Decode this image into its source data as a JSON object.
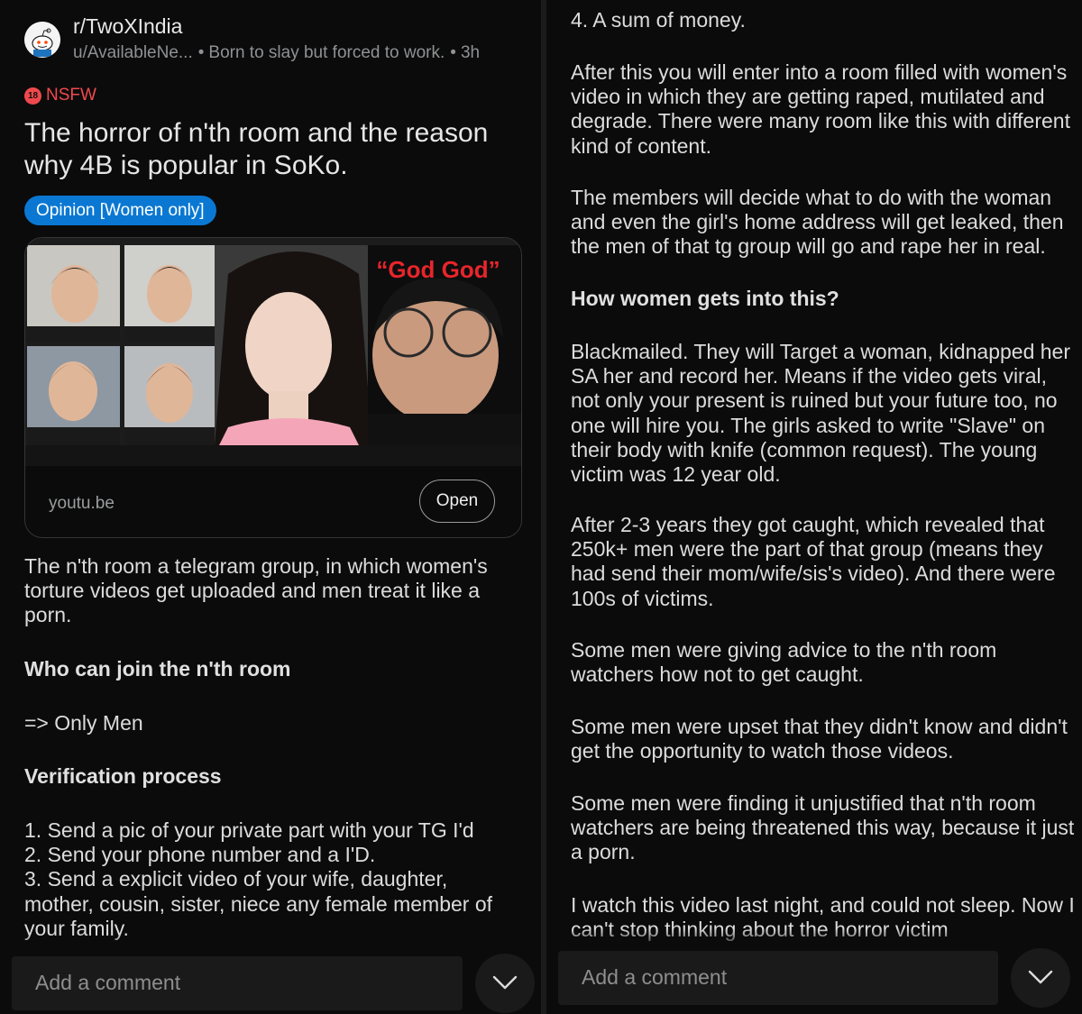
{
  "left": {
    "subreddit": "r/TwoXIndia",
    "username": "u/AvailableNe...",
    "tagline": "Born to slay but forced to work.",
    "time": "3h",
    "nsfw_badge": "18",
    "nsfw_label": "NSFW",
    "title": "The horror of n'th room and the reason why 4B is popular in SoKo.",
    "flair": "Opinion [Women only]",
    "preview": {
      "thumb_caption": "“God God”",
      "domain": "youtu.be",
      "open_label": "Open"
    },
    "paragraphs": [
      "The n'th room a telegram group, in which women's torture videos get uploaded and men treat it like a porn.",
      "Who can join the n'th room",
      "=> Only Men",
      "Verification process",
      "1. Send a pic of your private part with your TG I'd\n2. Send your phone number and a I'D.\n3. Send a explicit video of your wife, daughter, mother, cousin, sister, niece any female member of your family."
    ],
    "comment_placeholder": "Add a comment"
  },
  "right": {
    "paragraphs": [
      "4. A sum of money.",
      "After this you will enter into a room filled with women's video in which they are getting raped, mutilated and degrade. There were many room like this with different kind of content.",
      "The members will decide what to do with the woman and even the girl's home address will get leaked, then the men of that tg group will go and rape her in real.",
      "How women gets into this?",
      "Blackmailed. They will Target a woman, kidnapped her SA her and record her. Means if the video gets viral, not only your present is ruined but your future too, no one will hire you. The girls asked to write \"Slave\" on their body with knife (common request). The young victim was 12 year old.",
      "After 2-3 years they got caught, which revealed that 250k+ men were the part of that group (means they had send their mom/wife/sis's video). And there were 100s of victims.",
      "Some men were giving advice to the n'th room watchers how not to get caught.",
      "Some men were upset that they didn't know and didn't get the opportunity to watch those videos.",
      "Some men were finding it unjustified that n'th room watchers are being threatened this way, because it just a porn.",
      "I watch this video last night, and could not sleep. Now I can't stop thinking about the horror victim"
    ],
    "comment_placeholder": "Add a comment"
  },
  "colors": {
    "background": "#0b0b0b",
    "nsfw": "#f0494d",
    "flair": "#0a78d2",
    "comment_bar": "#1a1a1b"
  }
}
